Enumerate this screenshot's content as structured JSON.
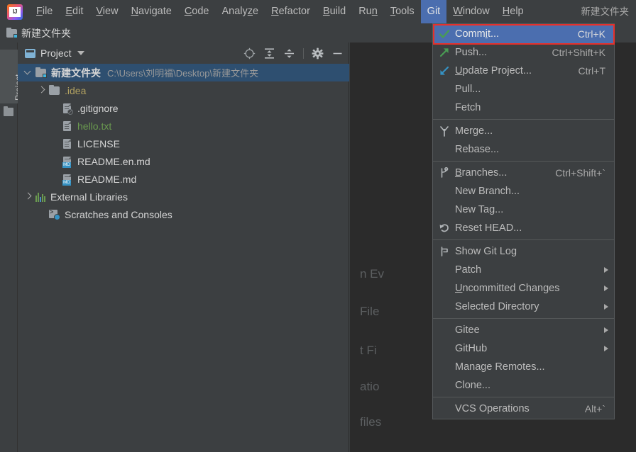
{
  "window": {
    "title": "新建文件夹",
    "accent_selection": "#4b6eaf",
    "annotation_color": "#e8302a",
    "tree_selection": "#2e4f70"
  },
  "menubar": {
    "logo_name": "intellij-idea-logo",
    "items": [
      {
        "label": "File",
        "mnemonic": "F",
        "active": false
      },
      {
        "label": "Edit",
        "mnemonic": "E",
        "active": false
      },
      {
        "label": "View",
        "mnemonic": "V",
        "active": false
      },
      {
        "label": "Navigate",
        "mnemonic": "N",
        "active": false
      },
      {
        "label": "Code",
        "mnemonic": "C",
        "active": false
      },
      {
        "label": "Analyze",
        "mnemonic": "z",
        "active": false
      },
      {
        "label": "Refactor",
        "mnemonic": "R",
        "active": false
      },
      {
        "label": "Build",
        "mnemonic": "B",
        "active": false
      },
      {
        "label": "Run",
        "mnemonic": "n",
        "active": false
      },
      {
        "label": "Tools",
        "mnemonic": "T",
        "active": false
      },
      {
        "label": "Git",
        "mnemonic": "",
        "active": true
      },
      {
        "label": "Window",
        "mnemonic": "W",
        "active": false
      },
      {
        "label": "Help",
        "mnemonic": "H",
        "active": false
      }
    ]
  },
  "navbar": {
    "icon": "folder-vcs-icon",
    "label": "新建文件夹"
  },
  "toolstrip": {
    "project_button": "Project",
    "second_icon": "folder-icon"
  },
  "project_panel": {
    "title": "Project",
    "window_icon": "project-tool-window-icon",
    "dropdown_icon": "chevron-down-icon",
    "tools": [
      {
        "name": "locate-file-icon",
        "title": "Select Opened File"
      },
      {
        "name": "expand-all-icon",
        "title": "Expand All"
      },
      {
        "name": "collapse-all-icon",
        "title": "Collapse All"
      },
      {
        "name": "gear-icon",
        "title": "Options"
      },
      {
        "name": "hide-icon",
        "title": "Hide"
      }
    ],
    "tree": [
      {
        "label": "新建文件夹",
        "path": "C:\\Users\\刘明福\\Desktop\\新建文件夹",
        "icon": "folder-vcs-icon",
        "indent": 0,
        "arrow": "open",
        "selected": true,
        "bold": true,
        "color": "default"
      },
      {
        "label": ".idea",
        "path": "",
        "icon": "folder-icon",
        "indent": 1,
        "arrow": "closed",
        "selected": false,
        "bold": false,
        "color": "yellow"
      },
      {
        "label": ".gitignore",
        "path": "",
        "icon": "file-ignored-icon",
        "indent": 2,
        "arrow": "none",
        "selected": false,
        "bold": false,
        "color": "default"
      },
      {
        "label": "hello.txt",
        "path": "",
        "icon": "file-text-icon",
        "indent": 2,
        "arrow": "none",
        "selected": false,
        "bold": false,
        "color": "green"
      },
      {
        "label": "LICENSE",
        "path": "",
        "icon": "file-text-icon",
        "indent": 2,
        "arrow": "none",
        "selected": false,
        "bold": false,
        "color": "default"
      },
      {
        "label": "README.en.md",
        "path": "",
        "icon": "file-markdown-icon",
        "indent": 2,
        "arrow": "none",
        "selected": false,
        "bold": false,
        "color": "default"
      },
      {
        "label": "README.md",
        "path": "",
        "icon": "file-markdown-icon",
        "indent": 2,
        "arrow": "none",
        "selected": false,
        "bold": false,
        "color": "default"
      },
      {
        "label": "External Libraries",
        "path": "",
        "icon": "libraries-icon",
        "indent": 0,
        "arrow": "closed",
        "selected": false,
        "bold": false,
        "color": "default"
      },
      {
        "label": "Scratches and Consoles",
        "path": "",
        "icon": "scratches-icon",
        "indent": 1,
        "arrow": "none",
        "selected": false,
        "bold": false,
        "color": "default"
      }
    ]
  },
  "editor": {
    "hint_lines": [
      "n Ev",
      "File",
      "t Fi",
      "atio",
      "files"
    ]
  },
  "git_menu": {
    "items": [
      {
        "type": "item",
        "label": "Commit...",
        "shortcut": "Ctrl+K",
        "icon": "commit-check-icon",
        "selected": true,
        "submenu": false,
        "mnemonic": "i"
      },
      {
        "type": "item",
        "label": "Push...",
        "shortcut": "Ctrl+Shift+K",
        "icon": "push-arrow-icon",
        "selected": false,
        "submenu": false,
        "mnemonic": ""
      },
      {
        "type": "item",
        "label": "Update Project...",
        "shortcut": "Ctrl+T",
        "icon": "update-arrow-icon",
        "selected": false,
        "submenu": false,
        "mnemonic": "U"
      },
      {
        "type": "item",
        "label": "Pull...",
        "shortcut": "",
        "icon": "",
        "selected": false,
        "submenu": false,
        "mnemonic": ""
      },
      {
        "type": "item",
        "label": "Fetch",
        "shortcut": "",
        "icon": "",
        "selected": false,
        "submenu": false,
        "mnemonic": ""
      },
      {
        "type": "separator"
      },
      {
        "type": "item",
        "label": "Merge...",
        "shortcut": "",
        "icon": "merge-icon",
        "selected": false,
        "submenu": false,
        "mnemonic": ""
      },
      {
        "type": "item",
        "label": "Rebase...",
        "shortcut": "",
        "icon": "",
        "selected": false,
        "submenu": false,
        "mnemonic": ""
      },
      {
        "type": "separator"
      },
      {
        "type": "item",
        "label": "Branches...",
        "shortcut": "Ctrl+Shift+`",
        "icon": "branch-icon",
        "selected": false,
        "submenu": false,
        "mnemonic": "B"
      },
      {
        "type": "item",
        "label": "New Branch...",
        "shortcut": "",
        "icon": "",
        "selected": false,
        "submenu": false,
        "mnemonic": ""
      },
      {
        "type": "item",
        "label": "New Tag...",
        "shortcut": "",
        "icon": "",
        "selected": false,
        "submenu": false,
        "mnemonic": ""
      },
      {
        "type": "item",
        "label": "Reset HEAD...",
        "shortcut": "",
        "icon": "reset-icon",
        "selected": false,
        "submenu": false,
        "mnemonic": ""
      },
      {
        "type": "separator"
      },
      {
        "type": "item",
        "label": "Show Git Log",
        "shortcut": "",
        "icon": "git-log-icon",
        "selected": false,
        "submenu": false,
        "mnemonic": ""
      },
      {
        "type": "item",
        "label": "Patch",
        "shortcut": "",
        "icon": "",
        "selected": false,
        "submenu": true,
        "mnemonic": ""
      },
      {
        "type": "item",
        "label": "Uncommitted Changes",
        "shortcut": "",
        "icon": "",
        "selected": false,
        "submenu": true,
        "mnemonic": "U"
      },
      {
        "type": "item",
        "label": "Selected Directory",
        "shortcut": "",
        "icon": "",
        "selected": false,
        "submenu": true,
        "mnemonic": ""
      },
      {
        "type": "separator"
      },
      {
        "type": "item",
        "label": "Gitee",
        "shortcut": "",
        "icon": "",
        "selected": false,
        "submenu": true,
        "mnemonic": ""
      },
      {
        "type": "item",
        "label": "GitHub",
        "shortcut": "",
        "icon": "",
        "selected": false,
        "submenu": true,
        "mnemonic": ""
      },
      {
        "type": "item",
        "label": "Manage Remotes...",
        "shortcut": "",
        "icon": "",
        "selected": false,
        "submenu": false,
        "mnemonic": ""
      },
      {
        "type": "item",
        "label": "Clone...",
        "shortcut": "",
        "icon": "",
        "selected": false,
        "submenu": false,
        "mnemonic": ""
      },
      {
        "type": "separator"
      },
      {
        "type": "item",
        "label": "VCS Operations",
        "shortcut": "Alt+`",
        "icon": "",
        "selected": false,
        "submenu": false,
        "mnemonic": ""
      }
    ]
  }
}
